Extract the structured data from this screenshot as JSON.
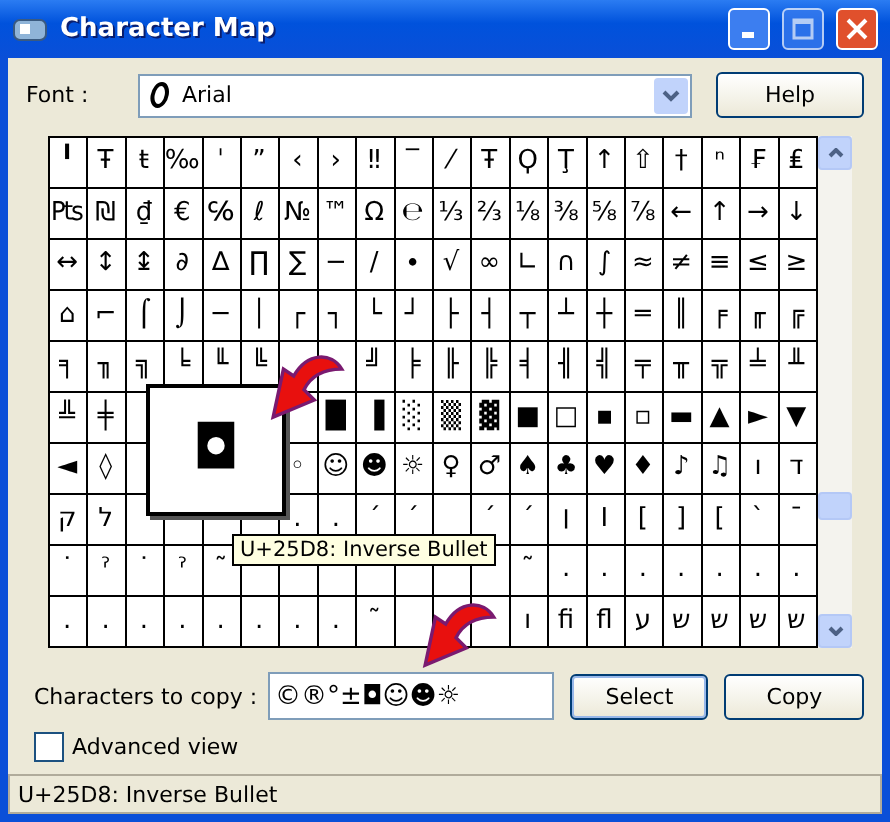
{
  "window": {
    "title": "Character Map"
  },
  "font": {
    "label": "Font :",
    "value": "Arial"
  },
  "help_button": "Help",
  "grid": {
    "rows": [
      [
        "╹",
        "Ŧ",
        "ŧ",
        "‰",
        "ˈ",
        "ˮ",
        "‹",
        "›",
        "‼",
        "‾",
        "⁄",
        "Ŧ",
        "Ϙ",
        "Ţ",
        "↑",
        "⇧",
        "†",
        "ⁿ",
        "₣",
        "₤"
      ],
      [
        "₧",
        "₪",
        "₫",
        "€",
        "℅",
        "ℓ",
        "№",
        "™",
        "Ω",
        "℮",
        "⅓",
        "⅔",
        "⅛",
        "⅜",
        "⅝",
        "⅞",
        "←",
        "↑",
        "→",
        "↓"
      ],
      [
        "↔",
        "↕",
        "↨",
        "∂",
        "∆",
        "∏",
        "∑",
        "−",
        "∕",
        "∙",
        "√",
        "∞",
        "∟",
        "∩",
        "∫",
        "≈",
        "≠",
        "≡",
        "≤",
        "≥"
      ],
      [
        "⌂",
        "⌐",
        "⌠",
        "⌡",
        "─",
        "│",
        "┌",
        "┐",
        "└",
        "┘",
        "├",
        "┤",
        "┬",
        "┴",
        "┼",
        "═",
        "║",
        "╒",
        "╓",
        "╔"
      ],
      [
        "╕",
        "╖",
        "╗",
        "╘",
        "╙",
        "╚",
        null,
        null,
        "╝",
        "╞",
        "╟",
        "╠",
        "╡",
        "╢",
        "╣",
        "╤",
        "╥",
        "╦",
        "╧",
        "╨"
      ],
      [
        "╩",
        "╪",
        null,
        null,
        null,
        null,
        null,
        "█",
        "▐",
        "░",
        "▒",
        "▓",
        "■",
        "□",
        "▪",
        "▫",
        "▬",
        "▲",
        "►",
        "▼"
      ],
      [
        "◄",
        "◊",
        null,
        null,
        null,
        null,
        "◦",
        "☺",
        "☻",
        "☼",
        "♀",
        "♂",
        "♠",
        "♣",
        "♥",
        "♦",
        "♪",
        "♫",
        "ו",
        "ד"
      ],
      [
        "ק",
        "ל",
        null,
        null,
        null,
        null,
        "․",
        "․",
        "ˊ",
        "ˊ",
        null,
        "ˊ",
        "ˊ",
        "׀",
        "I",
        "[",
        "]",
        "[",
        "ˋ",
        "ˉ"
      ],
      [
        "˙",
        "ˀ",
        "˙",
        "ˀ",
        "˜",
        null,
        null,
        null,
        null,
        null,
        null,
        null,
        "˜",
        ".",
        ".",
        ".",
        ".",
        ".",
        ".",
        "."
      ],
      [
        ".",
        ".",
        ".",
        ".",
        ".",
        ".",
        ".",
        ".",
        "˜",
        null,
        null,
        null,
        "ı",
        "ﬁ",
        "ﬂ",
        "ע",
        "ש",
        "ש",
        "ש",
        "ש"
      ]
    ]
  },
  "magnifier": {
    "char": "◘"
  },
  "tooltip": "U+25D8: Inverse Bullet",
  "copy": {
    "label": "Characters to copy :",
    "value": "©®°±◘☺☻☼"
  },
  "select_button": "Select",
  "copy_button": "Copy",
  "advanced_view": {
    "label": "Advanced view",
    "checked": false
  },
  "status_bar": "U+25D8: Inverse Bullet"
}
